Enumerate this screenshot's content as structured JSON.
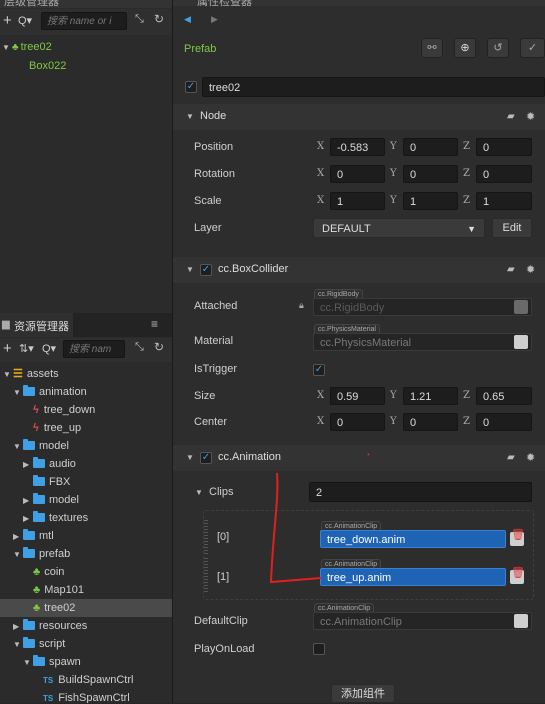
{
  "hierarchy": {
    "title": "层级管理器",
    "search_placeholder": "搜索 name or i",
    "nodes": [
      {
        "label": "tree02",
        "expanded": true
      },
      {
        "label": "Box022"
      }
    ]
  },
  "assets": {
    "title": "资源管理器",
    "search_placeholder": "搜索 nam",
    "rows": [
      {
        "label": "assets",
        "kind": "db",
        "indent": 0,
        "arrow": "down"
      },
      {
        "label": "animation",
        "kind": "folder",
        "indent": 1,
        "arrow": "down"
      },
      {
        "label": "tree_down",
        "kind": "anim",
        "indent": 2
      },
      {
        "label": "tree_up",
        "kind": "anim",
        "indent": 2
      },
      {
        "label": "model",
        "kind": "folder",
        "indent": 1,
        "arrow": "down"
      },
      {
        "label": "audio",
        "kind": "folder",
        "indent": 2,
        "arrow": "right"
      },
      {
        "label": "FBX",
        "kind": "folder",
        "indent": 2
      },
      {
        "label": "model",
        "kind": "folder",
        "indent": 2,
        "arrow": "right"
      },
      {
        "label": "textures",
        "kind": "folder",
        "indent": 2,
        "arrow": "right"
      },
      {
        "label": "mtl",
        "kind": "folder",
        "indent": 1,
        "arrow": "right"
      },
      {
        "label": "prefab",
        "kind": "folder",
        "indent": 1,
        "arrow": "down"
      },
      {
        "label": "coin",
        "kind": "prefab",
        "indent": 2
      },
      {
        "label": "Map101",
        "kind": "prefab",
        "indent": 2
      },
      {
        "label": "tree02",
        "kind": "prefab",
        "indent": 2,
        "selected": true
      },
      {
        "label": "resources",
        "kind": "folder",
        "indent": 1,
        "arrow": "right"
      },
      {
        "label": "script",
        "kind": "folder",
        "indent": 1,
        "arrow": "down"
      },
      {
        "label": "spawn",
        "kind": "folder",
        "indent": 2,
        "arrow": "down"
      },
      {
        "label": "BuildSpawnCtrl",
        "kind": "ts",
        "indent": 3
      },
      {
        "label": "FishSpawnCtrl",
        "kind": "ts",
        "indent": 3
      }
    ]
  },
  "inspector": {
    "title": "属性检查器",
    "prefab_label": "Prefab",
    "node_name": "tree02",
    "node_section": "Node",
    "position": {
      "label": "Position",
      "x": "-0.583",
      "y": "0",
      "z": "0"
    },
    "rotation": {
      "label": "Rotation",
      "x": "0",
      "y": "0",
      "z": "0"
    },
    "scale": {
      "label": "Scale",
      "x": "1",
      "y": "1",
      "z": "1"
    },
    "layer": {
      "label": "Layer",
      "value": "DEFAULT",
      "edit": "Edit"
    },
    "axis": {
      "x": "X",
      "y": "Y",
      "z": "Z"
    },
    "box_collider": {
      "title": "cc.BoxCollider",
      "attached_label": "Attached",
      "attached_tag": "cc.RigidBody",
      "attached_value": "cc.RigidBody",
      "material_label": "Material",
      "material_tag": "cc.PhysicsMaterial",
      "material_value": "cc.PhysicsMaterial",
      "istrigger_label": "IsTrigger",
      "size": {
        "label": "Size",
        "x": "0.59",
        "y": "1.21",
        "z": "0.65"
      },
      "center": {
        "label": "Center",
        "x": "0",
        "y": "0",
        "z": "0"
      }
    },
    "animation": {
      "title": "cc.Animation",
      "clips_label": "Clips",
      "clips_count": "2",
      "clips": [
        {
          "index": "[0]",
          "tag": "cc.AnimationClip",
          "value": "tree_down.anim"
        },
        {
          "index": "[1]",
          "tag": "cc.AnimationClip",
          "value": "tree_up.anim"
        }
      ],
      "default_clip_label": "DefaultClip",
      "default_clip_tag": "cc.AnimationClip",
      "default_clip_value": "cc.AnimationClip",
      "play_on_load_label": "PlayOnLoad"
    },
    "add_component": "添加组件"
  },
  "colors": {
    "accent": "#3fa0e6",
    "green": "#7ec948",
    "selected": "#1f63b4",
    "annotation": "#e02020"
  }
}
